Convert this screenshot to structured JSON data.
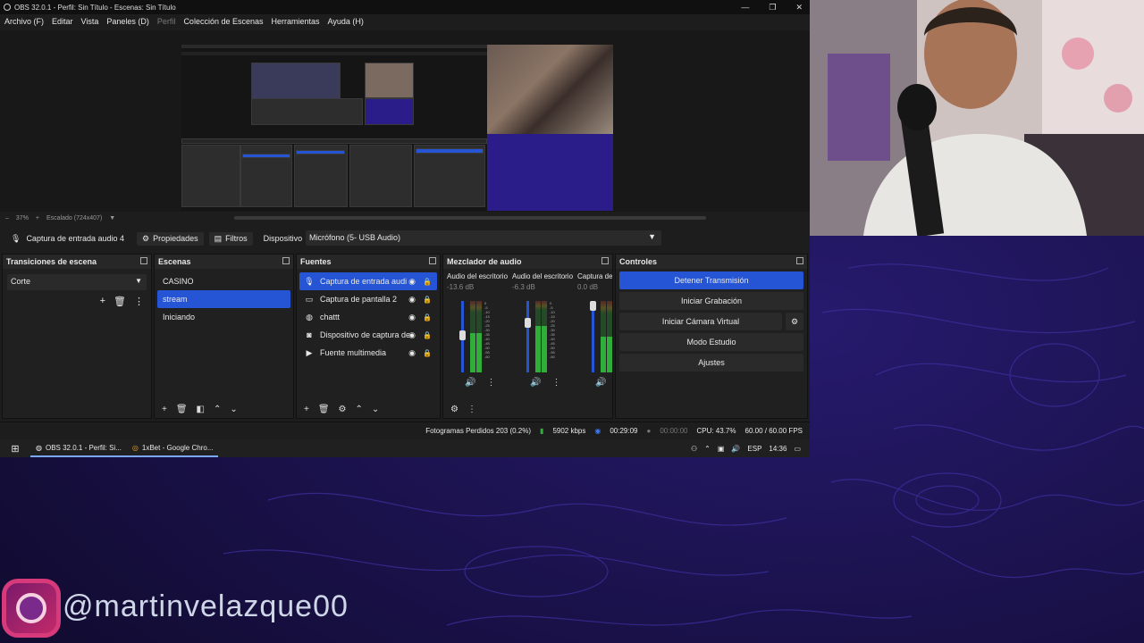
{
  "window_title": "OBS 32.0.1 - Perfil: Sin Título - Escenas: Sin Título",
  "window_buttons": [
    "—",
    "❐",
    "✕"
  ],
  "menu": [
    {
      "label": "Archivo (F)",
      "enabled": true
    },
    {
      "label": "Editar",
      "enabled": true
    },
    {
      "label": "Vista",
      "enabled": true
    },
    {
      "label": "Paneles (D)",
      "enabled": true
    },
    {
      "label": "Perfil",
      "enabled": false
    },
    {
      "label": "Colección de Escenas",
      "enabled": true
    },
    {
      "label": "Herramientas",
      "enabled": true
    },
    {
      "label": "Ayuda (H)",
      "enabled": true
    }
  ],
  "preview": {
    "zoom": "37%",
    "scale_label": "Escalado (724x407)",
    "minus": "–",
    "plus": "+"
  },
  "source_toolbar": {
    "source_name": "Captura de entrada audio 4",
    "properties": "Propiedades",
    "filters": "Filtros",
    "device_label": "Dispositivo",
    "device_value": "Micrófono (5- USB Audio)"
  },
  "transitions": {
    "title": "Transiciones de escena",
    "selected": "Corte"
  },
  "scenes": {
    "title": "Escenas",
    "items": [
      {
        "label": "CASINO",
        "selected": false
      },
      {
        "label": "stream",
        "selected": true
      },
      {
        "label": "Iniciando",
        "selected": false
      }
    ]
  },
  "sources": {
    "title": "Fuentes",
    "items": [
      {
        "label": "Captura de entrada audi",
        "icon": "mic-icon",
        "glyph": "🎙",
        "selected": true
      },
      {
        "label": "Captura de pantalla 2",
        "icon": "monitor-icon",
        "glyph": "▭",
        "selected": false
      },
      {
        "label": "chattt",
        "icon": "globe-icon",
        "glyph": "◍",
        "selected": false
      },
      {
        "label": "Dispositivo de captura de",
        "icon": "camera-icon",
        "glyph": "◙",
        "selected": false
      },
      {
        "label": "Fuente multimedia",
        "icon": "play-icon",
        "glyph": "▶",
        "selected": false
      }
    ]
  },
  "mixer": {
    "title": "Mezclador de audio",
    "channels": [
      {
        "name": "Audio del escritorio",
        "db": "-13.6 dB",
        "level": 0.55,
        "fader": 0.55
      },
      {
        "name": "Audio del escritorio",
        "db": "-6.3 dB",
        "level": 0.65,
        "fader": 0.75
      },
      {
        "name": "Captura de",
        "db": "0.0 dB",
        "level": 0.5,
        "fader": 1.0
      }
    ],
    "ticks": [
      "0",
      "-5",
      "-10",
      "-15",
      "-20",
      "-25",
      "-30",
      "-35",
      "-40",
      "-45",
      "-50",
      "-55",
      "-60"
    ]
  },
  "controls": {
    "title": "Controles",
    "buttons": [
      {
        "label": "Detener Transmisión",
        "primary": true
      },
      {
        "label": "Iniciar Grabación",
        "primary": false
      },
      {
        "label": "Iniciar Cámara Virtual",
        "primary": false
      },
      {
        "label": "Modo Estudio",
        "primary": false
      },
      {
        "label": "Ajustes",
        "primary": false
      }
    ]
  },
  "status": {
    "dropped": "Fotogramas Perdidos 203 (0.2%)",
    "bitrate": "5902 kbps",
    "stream_time": "00:29:09",
    "rec_time": "00:00:00",
    "cpu": "CPU: 43.7%",
    "fps": "60.00 / 60.00 FPS"
  },
  "taskbar": {
    "tasks": [
      "OBS 32.0.1 - Perfil: Si...",
      "1xBet - Google Chro..."
    ],
    "lang": "ESP",
    "time": "14:36"
  },
  "overlay": {
    "handle": "@martinvelazque00"
  },
  "colors": {
    "accent": "#2555d4",
    "panel": "#1d1d1d",
    "background": "#150f3a",
    "instagram": "#d63a7a"
  }
}
